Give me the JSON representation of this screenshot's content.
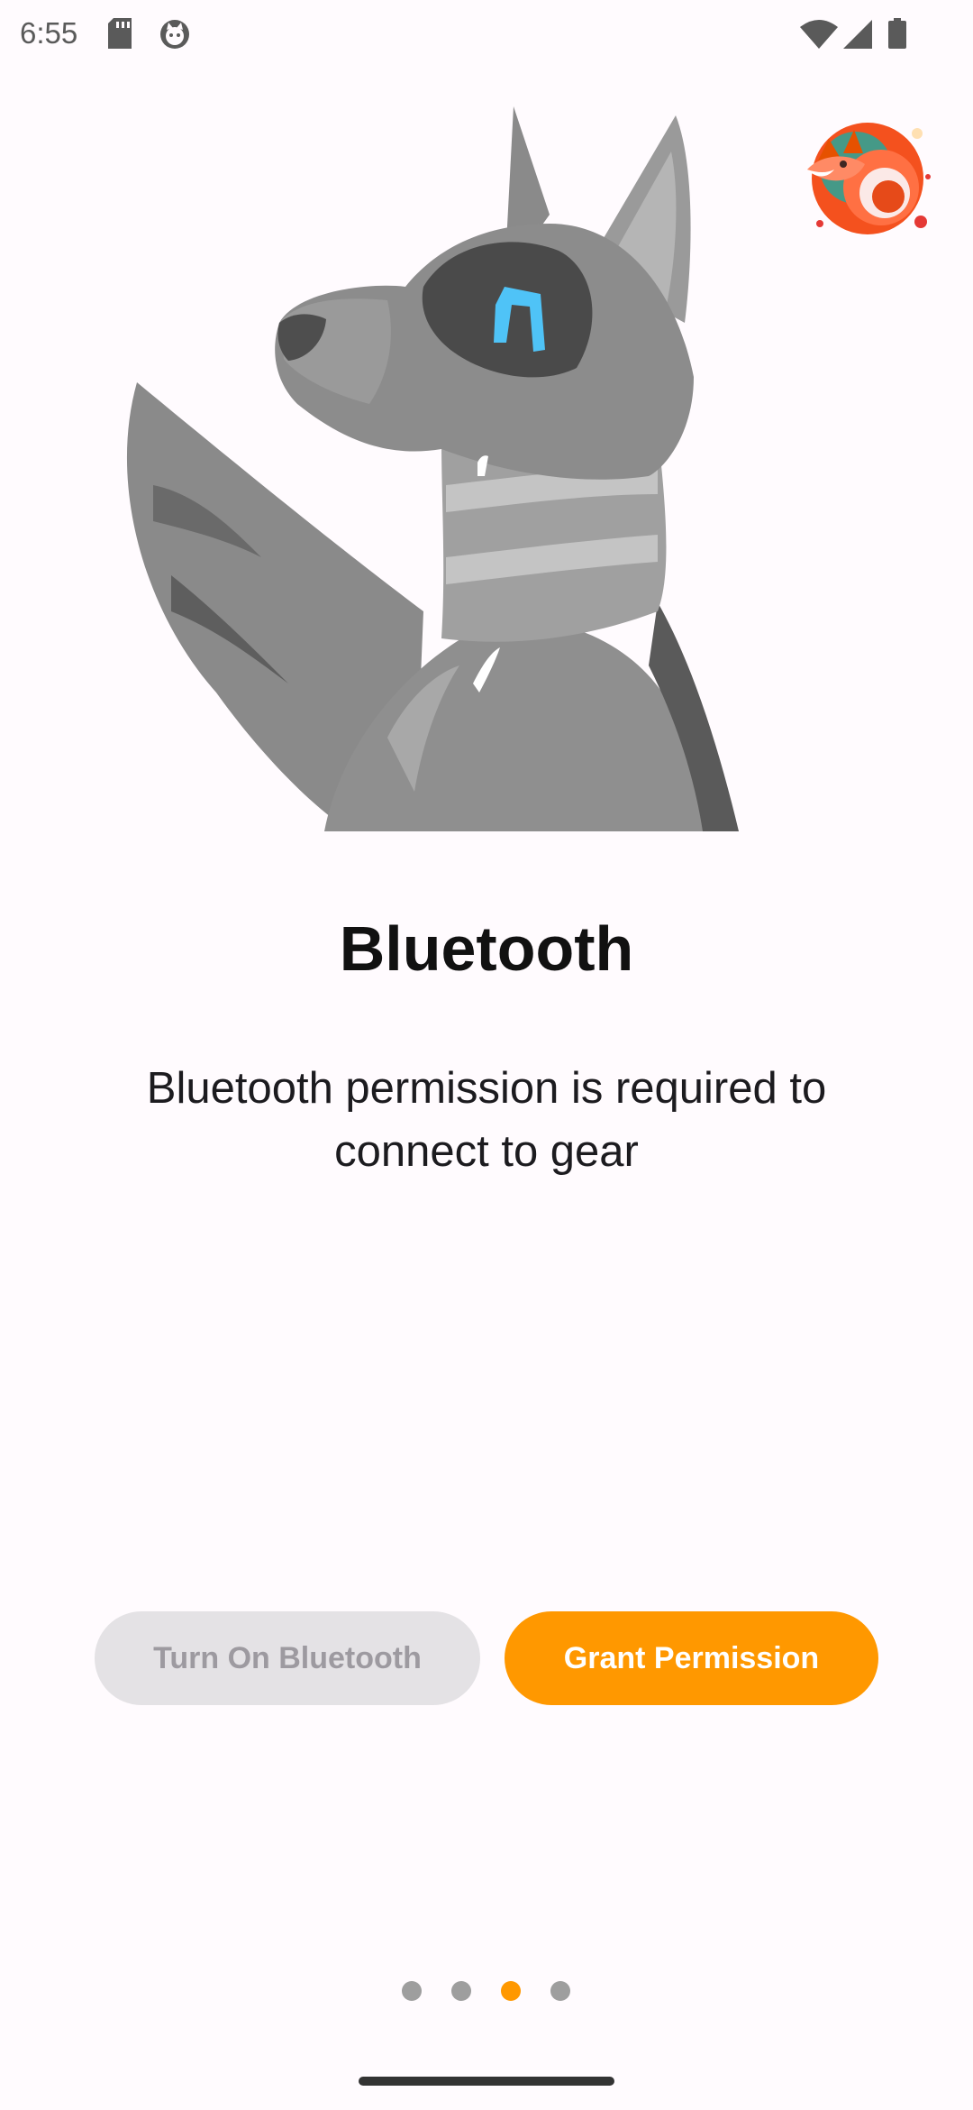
{
  "status_bar": {
    "time": "6:55",
    "icons": [
      "sd-card-icon",
      "cat-notification-icon",
      "wifi-icon",
      "signal-icon",
      "battery-icon"
    ]
  },
  "hero": {
    "image": "wolf-with-headphones-illustration",
    "avatar": "fox-logo-avatar"
  },
  "page": {
    "title": "Bluetooth",
    "description": "Bluetooth permission is required to connect to gear"
  },
  "buttons": {
    "turn_on_label": "Turn On Bluetooth",
    "grant_label": "Grant Permission"
  },
  "pager": {
    "total": 4,
    "active_index": 2
  },
  "colors": {
    "accent": "#ff9800",
    "disabled_bg": "#e4e2e5",
    "disabled_text": "#9d9aa0",
    "background": "#fffbfe",
    "inactive_dot": "#9e9e9e"
  }
}
